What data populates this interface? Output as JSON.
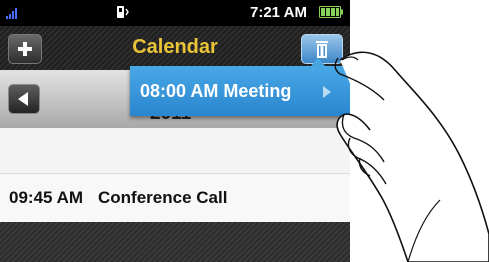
{
  "status_bar": {
    "time": "7:21 AM",
    "icons": [
      "signal-icon",
      "vibrate-icon",
      "battery-icon"
    ]
  },
  "header": {
    "title": "Calendar",
    "left_icon": "plus-icon",
    "right_icon": "trash-icon"
  },
  "date_bar": {
    "year": "2011",
    "prev_icon": "left-arrow-icon"
  },
  "popup": {
    "text": "08:00 AM Meeting",
    "arrow_icon": "right-arrow-icon"
  },
  "events": [
    {
      "time": "09:45 AM",
      "title": "Conference Call"
    }
  ],
  "colors": {
    "title": "#e9c436",
    "popup": "#3a9ad9",
    "accent_button": "#5da4e0"
  }
}
